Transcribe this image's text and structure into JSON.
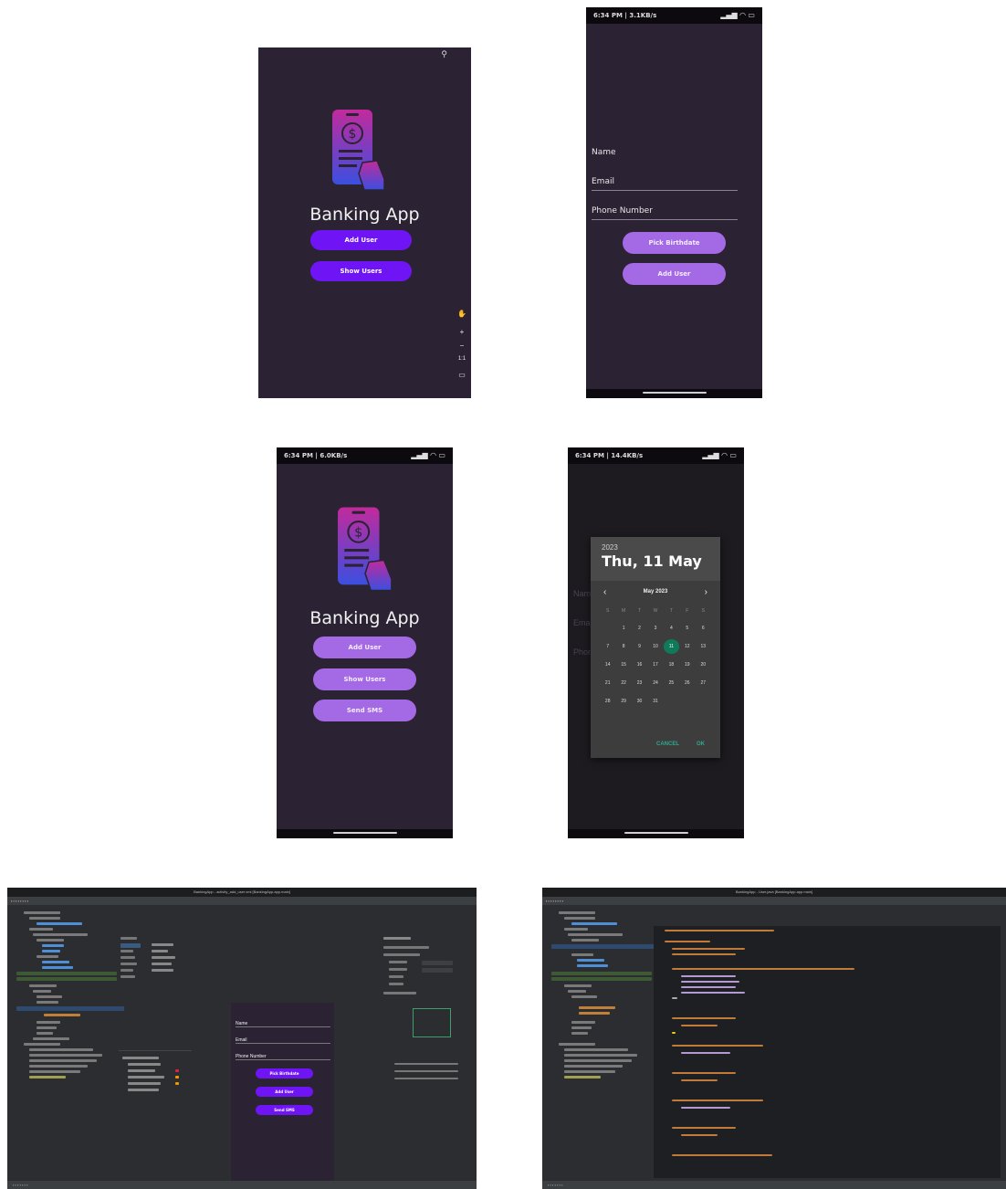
{
  "screen1": {
    "app_title": "Banking App",
    "add_user": "Add User",
    "show_users": "Show Users"
  },
  "screen2": {
    "status_time": "6:34 PM | 3.1KB/s",
    "name_label": "Name",
    "email_label": "Email",
    "phone_label": "Phone Number",
    "pick_birthdate": "Pick Birthdate",
    "add_user": "Add User"
  },
  "screen3": {
    "status_time": "6:34 PM | 6.0KB/s",
    "app_title": "Banking App",
    "add_user": "Add User",
    "show_users": "Show Users",
    "send_sms": "Send SMS"
  },
  "screen4": {
    "status_time": "6:34 PM | 14.4KB/s",
    "year": "2023",
    "selected_date": "Thu, 11 May",
    "month_label": "May 2023",
    "weekdays": [
      "S",
      "M",
      "T",
      "W",
      "T",
      "F",
      "S"
    ],
    "weeks": [
      [
        "",
        "1",
        "2",
        "3",
        "4",
        "5",
        "6"
      ],
      [
        "7",
        "8",
        "9",
        "10",
        "11",
        "12",
        "13"
      ],
      [
        "14",
        "15",
        "16",
        "17",
        "18",
        "19",
        "20"
      ],
      [
        "21",
        "22",
        "23",
        "24",
        "25",
        "26",
        "27"
      ],
      [
        "28",
        "29",
        "30",
        "31",
        "",
        "",
        ""
      ]
    ],
    "selected_day": "11",
    "cancel": "CANCEL",
    "ok": "OK",
    "bg_labels": [
      "Name",
      "Email",
      "Phone"
    ]
  },
  "ide1": {
    "window_title": "BankingApp - activity_add_user.xml [BankingApp.app.main]",
    "preview": {
      "name_label": "Name",
      "email_label": "Email",
      "phone_label": "Phone Number",
      "pick_birthdate": "Pick Birthdate",
      "add_user": "Add User",
      "send_sms": "Send SMS"
    }
  },
  "ide2": {
    "window_title": "BankingApp - User.java [BankingApp.app.main]"
  },
  "colors": {
    "phone_bg": "#2b2333",
    "primary": "#6f14f5",
    "primary_soft": "#a46ae6",
    "selected_day": "#0f7a5a",
    "ide_bg": "#2b2d30"
  }
}
